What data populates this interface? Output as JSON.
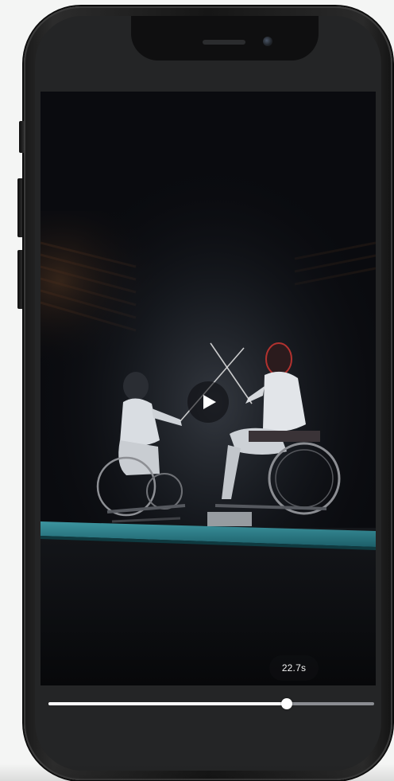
{
  "video": {
    "elapsed_label": "22.7s",
    "progress_fraction": 0.732,
    "playing": false
  },
  "icons": {
    "play": "play-icon",
    "speaker": "speaker-grille",
    "camera": "front-camera"
  },
  "colors": {
    "page_background": "#f4f5f4",
    "phone_frame": "#1b1b1b",
    "screen_background": "#242526",
    "progress_fill": "#ffffff",
    "progress_track": "#8b8d92",
    "fencing_strip": "#2a7f8a"
  }
}
